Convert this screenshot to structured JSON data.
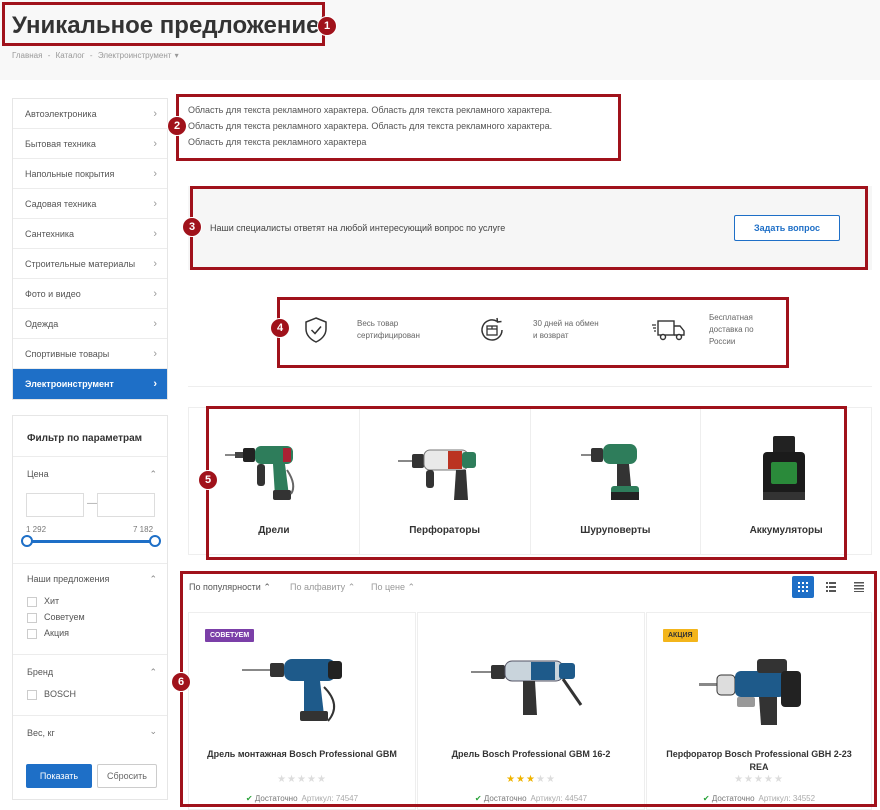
{
  "page": {
    "title": "Уникальное предложение!",
    "breadcrumb": [
      "Главная",
      "-",
      "Каталог",
      "-",
      "Электроинструмент"
    ],
    "breadcrumb_caret": "▾"
  },
  "markers": [
    "1",
    "2",
    "3",
    "4",
    "5",
    "6"
  ],
  "sidebar": {
    "items": [
      {
        "label": "Автоэлектроника"
      },
      {
        "label": "Бытовая техника"
      },
      {
        "label": "Напольные покрытия"
      },
      {
        "label": "Садовая техника"
      },
      {
        "label": "Сантехника"
      },
      {
        "label": "Строительные материалы"
      },
      {
        "label": "Фото и видео"
      },
      {
        "label": "Одежда"
      },
      {
        "label": "Спортивные товары"
      },
      {
        "label": "Электроинструмент",
        "active": true
      }
    ]
  },
  "filter": {
    "title": "Фильтр по параметрам",
    "price": {
      "title": "Цена",
      "min_label": "1 292",
      "max_label": "7 182",
      "dash": "—"
    },
    "offers": {
      "title": "Наши предложения",
      "options": [
        "Хит",
        "Советуем",
        "Акция"
      ]
    },
    "brand": {
      "title": "Бренд",
      "options": [
        "BOSCH"
      ]
    },
    "weight": {
      "title": "Вес, кг"
    },
    "show_label": "Показать",
    "reset_label": "Сбросить"
  },
  "promo": {
    "lines": [
      "Область для текста рекламного характера. Область для текста рекламного характера.",
      "Область для текста рекламного характера. Область для текста рекламного характера.",
      "Область для текста рекламного характера"
    ]
  },
  "question": {
    "text": "Наши специалисты ответят на любой интересующий вопрос по услуге",
    "button": "Задать вопрос"
  },
  "benefits": [
    {
      "icon": "shield-check-icon",
      "line1": "Весь товар",
      "line2": "сертифицирован",
      "line3": ""
    },
    {
      "icon": "return-box-icon",
      "line1": "30 дней на обмен",
      "line2": "и возврат",
      "line3": ""
    },
    {
      "icon": "delivery-truck-icon",
      "line1": "Бесплатная",
      "line2": "доставка по",
      "line3": "России"
    }
  ],
  "categories": [
    {
      "label": "Дрели"
    },
    {
      "label": "Перфораторы"
    },
    {
      "label": "Шуруповерты"
    },
    {
      "label": "Аккумуляторы"
    }
  ],
  "sort": {
    "options": [
      "По популярности",
      "По алфавиту",
      "По цене"
    ],
    "caret": "⌃"
  },
  "products": [
    {
      "badge": "СОВЕТУЕМ",
      "badge_color": "#7b3fa8",
      "name": "Дрель монтажная Bosch Professional GBM",
      "rating": 0,
      "stock": "Достаточно",
      "article": "Артикул: 74547"
    },
    {
      "badge": "",
      "badge_color": "",
      "name": "Дрель Bosch Professional GBM 16-2",
      "rating": 3,
      "stock": "Достаточно",
      "article": "Артикул: 44547"
    },
    {
      "badge": "АКЦИЯ",
      "badge_color": "#f3b51b",
      "name": "Перфоратор Bosch Professional GBH 2-23 REA",
      "rating": 0,
      "stock": "Достаточно",
      "article": "Артикул: 34552"
    }
  ],
  "colors": {
    "accent": "#1e6fc7",
    "annotation": "#a0121b",
    "star": "#f0b400"
  }
}
